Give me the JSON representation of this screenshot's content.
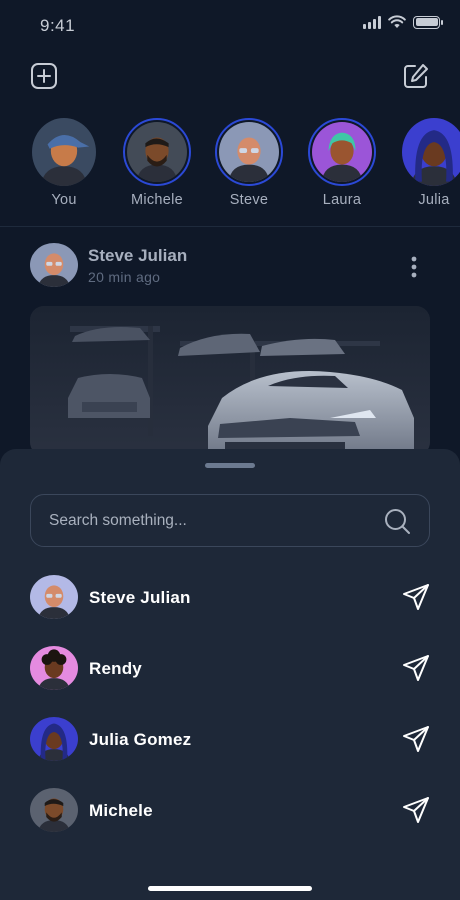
{
  "status": {
    "time": "9:41"
  },
  "stories": [
    {
      "name": "You",
      "bg": "#3a4a61",
      "skin": "#c77b49",
      "extra": "cap",
      "ring": false
    },
    {
      "name": "Michele",
      "bg": "#434b57",
      "skin": "#7b4a2a",
      "extra": "beard",
      "ring": true
    },
    {
      "name": "Steve",
      "bg": "#8b98b6",
      "skin": "#d48b6a",
      "extra": "bald",
      "ring": true
    },
    {
      "name": "Laura",
      "bg": "#9b55d8",
      "skin": "#9a5530",
      "extra": "hair",
      "ring": true
    },
    {
      "name": "Julia",
      "bg": "#3b3fcf",
      "skin": "#6a3a20",
      "extra": "hijab",
      "ring": false
    }
  ],
  "post": {
    "author": "Steve Julian",
    "time": "20 min ago"
  },
  "sheet": {
    "search_placeholder": "Search something...",
    "contacts": [
      {
        "name": "Steve Julian",
        "bg": "#b3b9e6",
        "skin": "#d48b6a",
        "extra": "bald"
      },
      {
        "name": "Rendy",
        "bg": "#e58be0",
        "skin": "#6a3a20",
        "extra": "curly"
      },
      {
        "name": "Julia Gomez",
        "bg": "#3b3fcf",
        "skin": "#6a3a20",
        "extra": "hijab"
      },
      {
        "name": "Michele",
        "bg": "#5b6270",
        "skin": "#7b4a2a",
        "extra": "beard"
      }
    ]
  },
  "colors": {
    "accent": "#2b49d6",
    "background": "#0f1828",
    "sheet": "#1e2838"
  },
  "icons": {
    "add": "plus-square-icon",
    "compose": "edit-icon",
    "menu": "more-vertical-icon",
    "search": "search-icon",
    "send": "send-icon"
  }
}
